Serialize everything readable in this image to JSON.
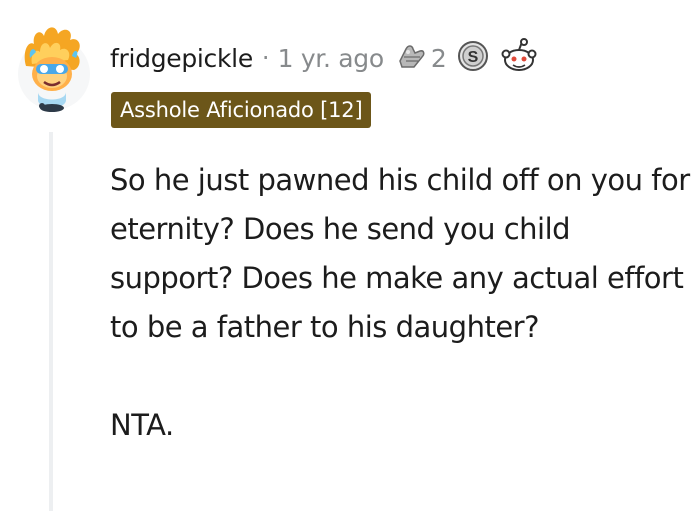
{
  "comment": {
    "username": "fridgepickle",
    "separator": "·",
    "timestamp": "1 yr. ago",
    "award_count": "2",
    "awards": [
      "helpful-award-icon",
      "silver-award-icon",
      "snoo-award-icon"
    ],
    "flair": "Asshole Aficionado [12]",
    "flair_color": "#6c5619",
    "body": [
      "So he just pawned his child off on you for eternity? Does he send you child support? Does he make any actual effort to be a father to his daughter?",
      "NTA."
    ]
  }
}
